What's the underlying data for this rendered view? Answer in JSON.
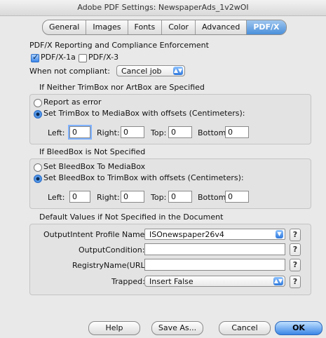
{
  "window": {
    "title": "Adobe PDF Settings: NewspaperAds_1v2wOI"
  },
  "tabs": [
    {
      "label": "General",
      "active": false
    },
    {
      "label": "Images",
      "active": false
    },
    {
      "label": "Fonts",
      "active": false
    },
    {
      "label": "Color",
      "active": false
    },
    {
      "label": "Advanced",
      "active": false
    },
    {
      "label": "PDF/X",
      "active": true
    }
  ],
  "reporting": {
    "heading": "PDF/X Reporting and Compliance Enforcement",
    "pdfx1a": {
      "label": "PDF/X-1a",
      "checked": true
    },
    "pdfx3": {
      "label": "PDF/X-3",
      "checked": false
    },
    "noncompliant_label": "When not compliant:",
    "noncompliant_value": "Cancel job"
  },
  "trimbox": {
    "heading": "If Neither TrimBox nor ArtBox are Specified",
    "option_report": "Report as error",
    "option_set": "Set TrimBox to MediaBox with offsets (Centimeters):",
    "selected": "set",
    "left_label": "Left:",
    "left_value": "0",
    "right_label": "Right:",
    "right_value": "0",
    "top_label": "Top:",
    "top_value": "0",
    "bottom_label": "Bottom:",
    "bottom_value": "0"
  },
  "bleedbox": {
    "heading": "If BleedBox is Not Specified",
    "option_media": "Set BleedBox To MediaBox",
    "option_trim": "Set BleedBox to TrimBox with offsets (Centimeters):",
    "selected": "trim",
    "left_label": "Left:",
    "left_value": "0",
    "right_label": "Right:",
    "right_value": "0",
    "top_label": "Top:",
    "top_value": "0",
    "bottom_label": "Bottom:",
    "bottom_value": "0"
  },
  "defaults": {
    "heading": "Default Values if Not Specified in the Document",
    "output_intent_label": "OutputIntent Profile Name:",
    "output_intent_value": "ISOnewspaper26v4",
    "output_condition_label": "OutputCondition:",
    "output_condition_value": "",
    "registry_label": "RegistryName(URL):",
    "registry_value": "",
    "trapped_label": "Trapped:",
    "trapped_value": "Insert False",
    "help_glyph": "?"
  },
  "buttons": {
    "help": "Help",
    "save_as": "Save As...",
    "cancel": "Cancel",
    "ok": "OK"
  },
  "icons": {
    "popup_arrow": "updown-arrows-icon",
    "combo_arrow": "chevron-down-icon",
    "checkmark": "check-icon"
  }
}
